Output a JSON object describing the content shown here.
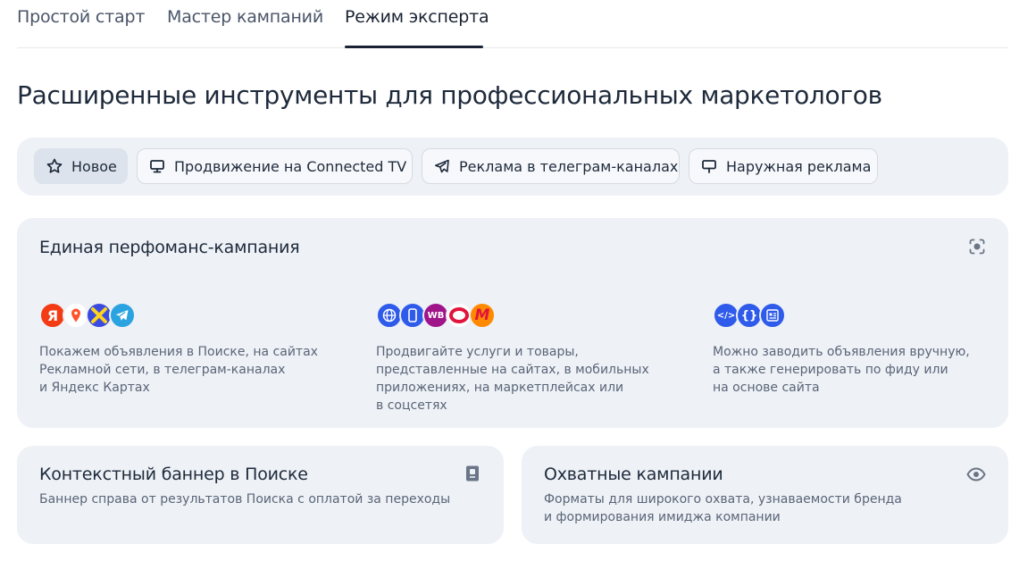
{
  "tabs": [
    {
      "label": "Простой старт",
      "active": false
    },
    {
      "label": "Мастер кампаний",
      "active": false
    },
    {
      "label": "Режим эксперта",
      "active": true
    }
  ],
  "heading": "Расширенные инструменты для профессиональных маркетологов",
  "chips": [
    {
      "label": "Новое",
      "icon": "star-icon",
      "selected": true
    },
    {
      "label": "Продвижение на Connected TV",
      "icon": "tv-icon",
      "selected": false
    },
    {
      "label": "Реклама в телеграм-каналах",
      "icon": "telegram-icon",
      "selected": false
    },
    {
      "label": "Наружная реклама",
      "icon": "billboard-icon",
      "selected": false
    }
  ],
  "performance_card": {
    "title": "Единая перфоманс-кампания",
    "icon": "scan-icon",
    "columns": [
      {
        "logos": [
          {
            "name": "yandex-logo",
            "glyph": "Я",
            "color": "#f33b14"
          },
          {
            "name": "maps-pin-logo",
            "glyph": "",
            "color": "#ff5226"
          },
          {
            "name": "yandex-games-logo",
            "glyph": "✕",
            "color": "#3a4be0"
          },
          {
            "name": "telegram-logo",
            "glyph": "",
            "color": "#2aa3e0"
          }
        ],
        "desc_lines": [
          "Покажем объявления в Поиске, на сайтах",
          "Рекламной сети, в телеграм-каналах",
          "и Яндекс Картах"
        ]
      },
      {
        "logos": [
          {
            "name": "web-globe-logo",
            "glyph": "",
            "color": "#2f5bea"
          },
          {
            "name": "mobile-app-logo",
            "glyph": "",
            "color": "#2f5bea"
          },
          {
            "name": "wildberries-logo",
            "glyph": "WB",
            "color": "#a0148a"
          },
          {
            "name": "ozon-logo",
            "glyph": "",
            "color": "#e0143c"
          },
          {
            "name": "yandex-market-logo",
            "glyph": "M",
            "color": "#ff8a00"
          }
        ],
        "desc_lines": [
          "Продвигайте услуги и товары,",
          "представленные на сайтах, в мобильных",
          "приложениях, на маркетплейсах или",
          "в соцсетях"
        ]
      },
      {
        "logos": [
          {
            "name": "code-logo",
            "glyph": "</>",
            "color": "#2f5bea"
          },
          {
            "name": "feed-braces-logo",
            "glyph": "{}",
            "color": "#2f5bea"
          },
          {
            "name": "site-article-logo",
            "glyph": "",
            "color": "#2f5bea"
          }
        ],
        "desc_lines": [
          "Можно заводить объявления вручную,",
          "а также генерировать по фиду или",
          "на основе сайта"
        ]
      }
    ]
  },
  "banner_card": {
    "title": "Контекстный баннер в Поиске",
    "icon": "banner-icon",
    "desc_lines": [
      "Баннер справа от результатов Поиска с оплатой за переходы"
    ]
  },
  "reach_card": {
    "title": "Охватные кампании",
    "icon": "eye-icon",
    "desc_lines": [
      "Форматы для широкого охвата, узнаваемости бренда",
      "и формирования имиджа компании"
    ]
  },
  "colors": {
    "accent": "#1a2333",
    "card_bg": "#eef1f6",
    "muted_text": "#5a6577"
  }
}
